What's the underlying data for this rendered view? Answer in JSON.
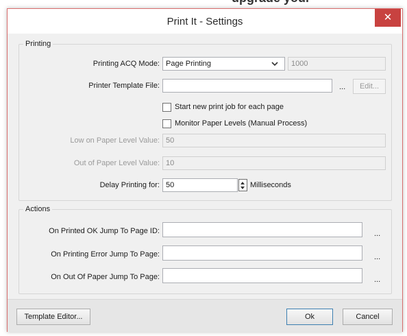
{
  "background_banner": {
    "text": "upgrade your"
  },
  "window": {
    "title": "Print It - Settings",
    "close_glyph": "✕",
    "accent_color": "#c84240"
  },
  "printing": {
    "group_label": "Printing",
    "acq_mode_label": "Printing ACQ Mode:",
    "acq_mode_value": "Page Printing",
    "acq_number": "1000",
    "template_file_label": "Printer Template File:",
    "template_file_value": "",
    "browse_dots": "...",
    "edit_button": "Edit...",
    "new_job_checkbox": {
      "label": "Start new print job for each page",
      "checked": false
    },
    "monitor_checkbox": {
      "label": "Monitor Paper Levels (Manual Process)",
      "checked": false
    },
    "low_level_label": "Low on Paper Level Value:",
    "low_level_value": "50",
    "out_level_label": "Out of Paper Level Value:",
    "out_level_value": "10",
    "delay_label": "Delay Printing for:",
    "delay_value": "50",
    "delay_unit": "Milliseconds"
  },
  "actions": {
    "group_label": "Actions",
    "ok_jump_label": "On Printed OK Jump To Page ID:",
    "ok_jump_value": "",
    "error_jump_label": "On Printing Error Jump To Page:",
    "error_jump_value": "",
    "out_jump_label": "On Out Of Paper Jump To Page:",
    "out_jump_value": "",
    "browse_dots": "..."
  },
  "footer": {
    "template_editor_button": "Template Editor...",
    "ok_button": "Ok",
    "cancel_button": "Cancel"
  }
}
